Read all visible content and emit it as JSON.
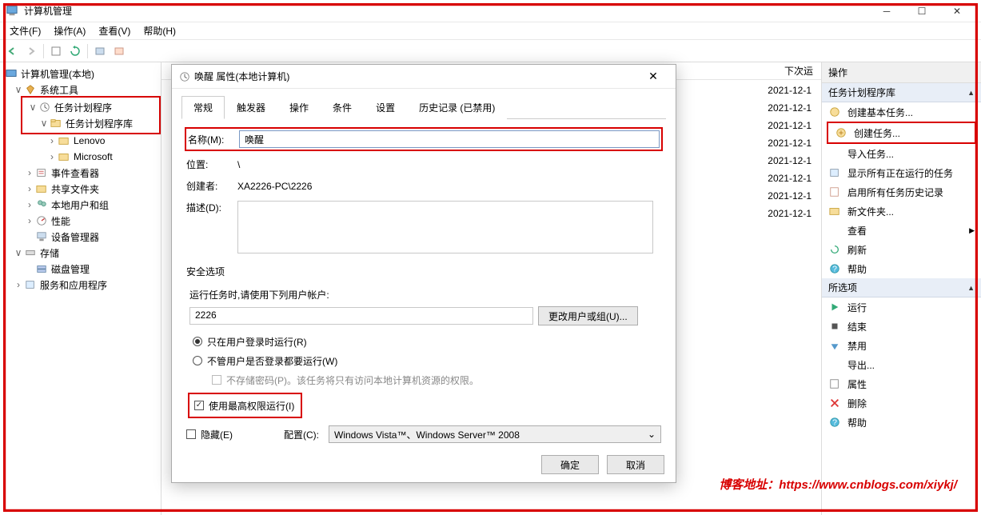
{
  "window": {
    "title": "计算机管理"
  },
  "menus": {
    "file": "文件(F)",
    "action": "操作(A)",
    "view": "查看(V)",
    "help": "帮助(H)"
  },
  "tree": {
    "root": "计算机管理(本地)",
    "system_tools": "系统工具",
    "task_scheduler": "任务计划程序",
    "task_lib": "任务计划程序库",
    "lenovo": "Lenovo",
    "microsoft": "Microsoft",
    "event_viewer": "事件查看器",
    "shared": "共享文件夹",
    "users": "本地用户和组",
    "perf": "性能",
    "devmgr": "设备管理器",
    "storage": "存储",
    "diskmgr": "磁盘管理",
    "services": "服务和应用程序"
  },
  "list": {
    "header_nextrun": "下次运",
    "dates": [
      "2021-12-1",
      "2021-12-1",
      "2021-12-1",
      "2021-12-1",
      "2021-12-1",
      "2021-12-1",
      "2021-12-1",
      "2021-12-1"
    ]
  },
  "actions": {
    "header": "操作",
    "group1": "任务计划程序库",
    "create_basic": "创建基本任务...",
    "create_task": "创建任务...",
    "import": "导入任务...",
    "show_running": "显示所有正在运行的任务",
    "enable_history": "启用所有任务历史记录",
    "new_folder": "新文件夹...",
    "view": "查看",
    "refresh": "刷新",
    "help": "帮助",
    "group2": "所选项",
    "run": "运行",
    "end": "结束",
    "disable": "禁用",
    "export": "导出...",
    "properties": "属性",
    "delete": "删除",
    "help2": "帮助"
  },
  "dialog": {
    "title": "唤醒 属性(本地计算机)",
    "tabs": {
      "general": "常规",
      "triggers": "触发器",
      "actions": "操作",
      "conditions": "条件",
      "settings": "设置",
      "history": "历史记录 (已禁用)"
    },
    "name_label": "名称(M):",
    "name_value": "唤醒",
    "location_label": "位置:",
    "location_value": "\\",
    "author_label": "创建者:",
    "author_value": "XA2226-PC\\2226",
    "desc_label": "描述(D):",
    "security_legend": "安全选项",
    "security_hint": "运行任务时,请使用下列用户帐户:",
    "user_value": "2226",
    "change_user": "更改用户或组(U)...",
    "run_logged": "只在用户登录时运行(R)",
    "run_whether": "不管用户是否登录都要运行(W)",
    "no_store_pw": "不存储密码(P)。该任务将只有访问本地计算机资源的权限。",
    "highest_priv": "使用最高权限运行(I)",
    "hidden": "隐藏(E)",
    "config_label": "配置(C):",
    "config_value": "Windows Vista™、Windows Server™ 2008",
    "ok": "确定",
    "cancel": "取消"
  },
  "watermark": "博客地址：https://www.cnblogs.com/xiykj/"
}
